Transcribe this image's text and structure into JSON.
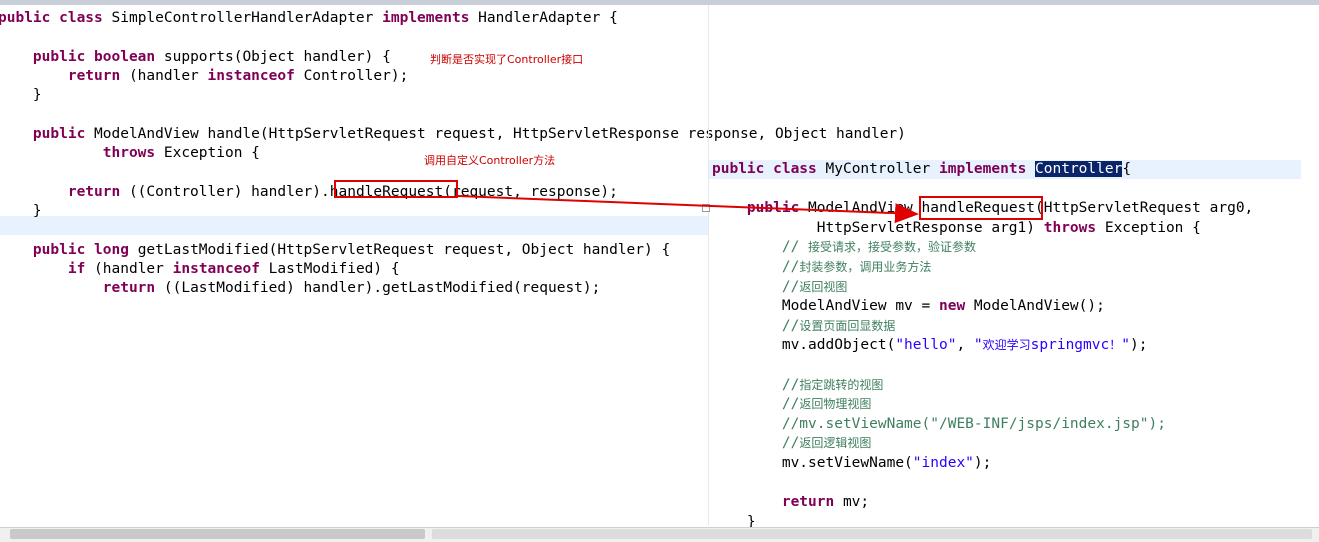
{
  "left": {
    "lines": [
      [
        {
          "t": "public ",
          "c": "kw"
        },
        {
          "t": "class ",
          "c": "kw"
        },
        {
          "t": "SimpleControllerHandlerAdapter "
        },
        {
          "t": "implements ",
          "c": "kw"
        },
        {
          "t": "HandlerAdapter {"
        }
      ],
      [],
      [
        {
          "t": "    "
        },
        {
          "t": "public ",
          "c": "kw"
        },
        {
          "t": "boolean ",
          "c": "kw"
        },
        {
          "t": "supports(Object handler) {"
        }
      ],
      [
        {
          "t": "        "
        },
        {
          "t": "return ",
          "c": "kw"
        },
        {
          "t": "(handler "
        },
        {
          "t": "instanceof ",
          "c": "kw"
        },
        {
          "t": "Controller);"
        }
      ],
      [
        {
          "t": "    }"
        }
      ],
      [],
      [
        {
          "t": "    "
        },
        {
          "t": "public ",
          "c": "kw"
        },
        {
          "t": "ModelAndView handle(HttpServletRequest request, HttpServletResponse response, Object handler)"
        }
      ],
      [
        {
          "t": "            "
        },
        {
          "t": "throws ",
          "c": "kw"
        },
        {
          "t": "Exception {"
        }
      ],
      [],
      [
        {
          "t": "        "
        },
        {
          "t": "return ",
          "c": "kw"
        },
        {
          "t": "((Controller) handler)."
        },
        {
          "t": "handleRequest"
        },
        {
          "t": "(request, response);"
        }
      ],
      [
        {
          "t": "    }"
        }
      ],
      [],
      [
        {
          "t": "    "
        },
        {
          "t": "public ",
          "c": "kw"
        },
        {
          "t": "long ",
          "c": "kw"
        },
        {
          "t": "getLastModified(HttpServletRequest request, Object handler) {"
        }
      ],
      [
        {
          "t": "        "
        },
        {
          "t": "if ",
          "c": "kw"
        },
        {
          "t": "(handler "
        },
        {
          "t": "instanceof ",
          "c": "kw"
        },
        {
          "t": "LastModified) {"
        }
      ],
      [
        {
          "t": "            "
        },
        {
          "t": "return ",
          "c": "kw"
        },
        {
          "t": "((LastModified) handler).getLastModified(request);"
        }
      ]
    ]
  },
  "right": {
    "lines": [
      [
        {
          "t": "public ",
          "c": "kw"
        },
        {
          "t": "class ",
          "c": "kw"
        },
        {
          "t": "MyController "
        },
        {
          "t": "implements ",
          "c": "kw"
        },
        {
          "t": "Controller",
          "c": "sel"
        },
        {
          "t": "{"
        }
      ],
      [],
      [
        {
          "t": "    "
        },
        {
          "t": "public ",
          "c": "kw"
        },
        {
          "t": "ModelAndView "
        },
        {
          "t": "handleRequest"
        },
        {
          "t": "(HttpServletRequest arg0,"
        }
      ],
      [
        {
          "t": "            HttpServletResponse arg1) "
        },
        {
          "t": "throws ",
          "c": "kw"
        },
        {
          "t": "Exception {"
        }
      ],
      [
        {
          "t": "        "
        },
        {
          "t": "// ",
          "c": "cmt"
        },
        {
          "t": "接受请求，接受参数，验证参数",
          "c": "cmt cjk"
        }
      ],
      [
        {
          "t": "        "
        },
        {
          "t": "//",
          "c": "cmt"
        },
        {
          "t": "封装参数，调用业务方法",
          "c": "cmt cjk"
        }
      ],
      [
        {
          "t": "        "
        },
        {
          "t": "//",
          "c": "cmt"
        },
        {
          "t": "返回视图",
          "c": "cmt cjk"
        }
      ],
      [
        {
          "t": "        ModelAndView mv = "
        },
        {
          "t": "new ",
          "c": "kw"
        },
        {
          "t": "ModelAndView();"
        }
      ],
      [
        {
          "t": "        "
        },
        {
          "t": "//",
          "c": "cmt"
        },
        {
          "t": "设置页面回显数据",
          "c": "cmt cjk"
        }
      ],
      [
        {
          "t": "        mv.addObject("
        },
        {
          "t": "\"hello\"",
          "c": "str"
        },
        {
          "t": ", "
        },
        {
          "t": "\"",
          "c": "str"
        },
        {
          "t": "欢迎学习",
          "c": "str cjk"
        },
        {
          "t": "springmvc",
          "c": "str"
        },
        {
          "t": "！",
          "c": "str cjk"
        },
        {
          "t": "\"",
          "c": "str"
        },
        {
          "t": ");"
        }
      ],
      [],
      [
        {
          "t": "        "
        },
        {
          "t": "//",
          "c": "cmt"
        },
        {
          "t": "指定跳转的视图",
          "c": "cmt cjk"
        }
      ],
      [
        {
          "t": "        "
        },
        {
          "t": "//",
          "c": "cmt"
        },
        {
          "t": "返回物理视图",
          "c": "cmt cjk"
        }
      ],
      [
        {
          "t": "        "
        },
        {
          "t": "//mv.setViewName(\"/WEB-INF/jsps/index.jsp\");",
          "c": "cmt"
        }
      ],
      [
        {
          "t": "        "
        },
        {
          "t": "//",
          "c": "cmt"
        },
        {
          "t": "返回逻辑视图",
          "c": "cmt cjk"
        }
      ],
      [
        {
          "t": "        mv.setViewName("
        },
        {
          "t": "\"index\"",
          "c": "str"
        },
        {
          "t": ");"
        }
      ],
      [],
      [
        {
          "t": "        "
        },
        {
          "t": "return ",
          "c": "kw"
        },
        {
          "t": "mv;"
        }
      ],
      [
        {
          "t": "    }"
        }
      ]
    ]
  },
  "annotations": {
    "supports_note": "判断是否实现了Controller接口",
    "handle_note": "调用自定义Controller方法"
  },
  "colors": {
    "keyword": "#7f0055",
    "string": "#2a00ff",
    "comment": "#3f7f5f",
    "annotation": "#cc0000",
    "selection": "#0a246a",
    "current_line": "#e8f2fe"
  }
}
